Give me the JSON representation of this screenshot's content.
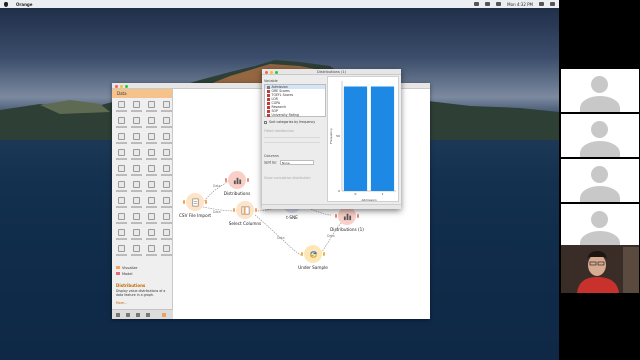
{
  "menubar": {
    "app_name": "Orange",
    "clock": "Mon 4:32 PM"
  },
  "dock": {
    "section_title": "Data",
    "widgets_count_note": "",
    "categories": [
      {
        "label": "Visualize",
        "color": "#f6a35b"
      },
      {
        "label": "Model",
        "color": "#e36b7b"
      }
    ],
    "help_title": "Distributions",
    "help_text": "Display value distributions of a data feature in a graph.",
    "help_more": "More..."
  },
  "nodes": [
    {
      "id": "csv",
      "label": "CSV File Import"
    },
    {
      "id": "dist",
      "label": "Distributions"
    },
    {
      "id": "select",
      "label": "Select Columns"
    },
    {
      "id": "tsne",
      "label": "t-SNE"
    },
    {
      "id": "dist1",
      "label": "Distributions (1)"
    },
    {
      "id": "sample",
      "label": "Under Sample"
    }
  ],
  "link_labels": [
    "Data",
    "Data",
    "Data",
    "Data",
    "Data",
    "Data"
  ],
  "dist_window": {
    "title": "Distributions (1)",
    "variable_header": "Variable",
    "variables": [
      {
        "name": "Admission",
        "color": "#7b7b7b"
      },
      {
        "name": "GRE Scores",
        "color": "#c23b3b"
      },
      {
        "name": "TOEFL Scores",
        "color": "#c23b3b"
      },
      {
        "name": "LOR",
        "color": "#c23b3b"
      },
      {
        "name": "CGPA",
        "color": "#c23b3b"
      },
      {
        "name": "Research",
        "color": "#c23b3b"
      },
      {
        "name": "SOP",
        "color": "#c23b3b"
      },
      {
        "name": "University Rating",
        "color": "#c23b3b"
      }
    ],
    "sort_label": "Sort categories by frequency",
    "fitted_label": "Fitted distribution",
    "columns_label": "Columns",
    "split_label": "Split by:",
    "split_value": "None",
    "cumulative_label": "Show cumulative distribution",
    "y_axis_label": "Frequency",
    "x_axis_label": "Admission"
  },
  "chart_data": {
    "type": "bar",
    "categories": [
      "0",
      "1"
    ],
    "values": [
      95,
      95
    ],
    "xlabel": "Admission",
    "ylabel": "Frequency",
    "ylim": [
      0,
      100
    ],
    "yticks": [
      "0",
      "50"
    ]
  }
}
